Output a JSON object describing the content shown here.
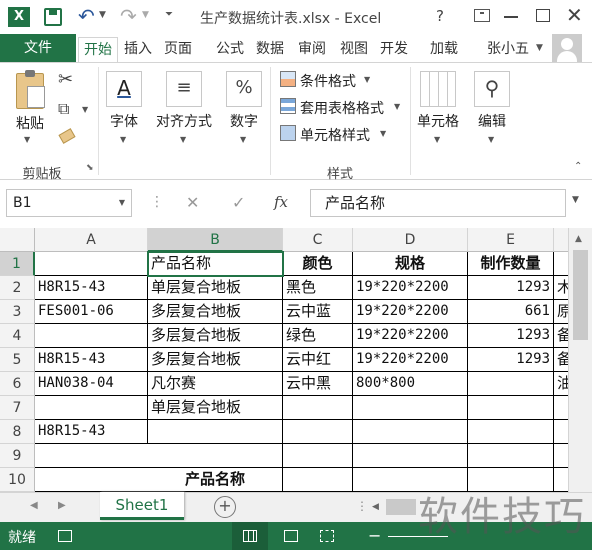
{
  "window": {
    "title": "生产数据统计表.xlsx - Excel",
    "help": "?"
  },
  "tabs": [
    "文件",
    "开始",
    "插入",
    "页面",
    "公式",
    "数据",
    "审阅",
    "视图",
    "开发",
    "加载"
  ],
  "user": "张小五",
  "ribbon": {
    "clipboard": {
      "paste": "粘贴",
      "group": "剪贴板"
    },
    "font": "字体",
    "align": "对齐方式",
    "number": "数字",
    "styles": {
      "cond": "条件格式",
      "table": "套用表格格式",
      "cell": "单元格样式",
      "group": "样式"
    },
    "cells": "单元格",
    "edit": "编辑"
  },
  "formula": {
    "namebox": "B1",
    "fx": "fx",
    "value": "产品名称"
  },
  "columns": [
    "A",
    "B",
    "C",
    "D",
    "E"
  ],
  "rows": [
    {
      "n": "1",
      "a": "",
      "b": "产品名称",
      "c": "颜色",
      "d": "规格",
      "e": "制作数量",
      "f": ""
    },
    {
      "n": "2",
      "a": "H8R15-43",
      "b": "单层复合地板",
      "c": "黑色",
      "d": "19*220*2200",
      "e": "1293",
      "f": "木"
    },
    {
      "n": "3",
      "a": "FES001-06",
      "b": "多层复合地板",
      "c": "云中蓝",
      "d": "19*220*2200",
      "e": "661",
      "f": "原"
    },
    {
      "n": "4",
      "a": "",
      "b": "多层复合地板",
      "c": "绿色",
      "d": "19*220*2200",
      "e": "1293",
      "f": "备"
    },
    {
      "n": "5",
      "a": "H8R15-43",
      "b": "多层复合地板",
      "c": "云中红",
      "d": "19*220*2200",
      "e": "1293",
      "f": "备"
    },
    {
      "n": "6",
      "a": "HAN038-04",
      "b": "凡尔赛",
      "c": "云中黑",
      "d": "800*800",
      "e": "",
      "f": "油"
    },
    {
      "n": "7",
      "a": "",
      "b": "单层复合地板",
      "c": "",
      "d": "",
      "e": "",
      "f": ""
    },
    {
      "n": "8",
      "a": "H8R15-43",
      "b": "",
      "c": "",
      "d": "",
      "e": "",
      "f": ""
    },
    {
      "n": "9",
      "a": "",
      "b": "",
      "c": "",
      "d": "",
      "e": "",
      "f": ""
    },
    {
      "n": "10",
      "a": "",
      "b": "产品名称",
      "c": "",
      "d": "",
      "e": "",
      "f": ""
    }
  ],
  "sheet": {
    "name": "Sheet1",
    "add": "+"
  },
  "status": {
    "ready": "就绪"
  },
  "watermark": "软件技巧",
  "colors": {
    "accent": "#217346"
  }
}
